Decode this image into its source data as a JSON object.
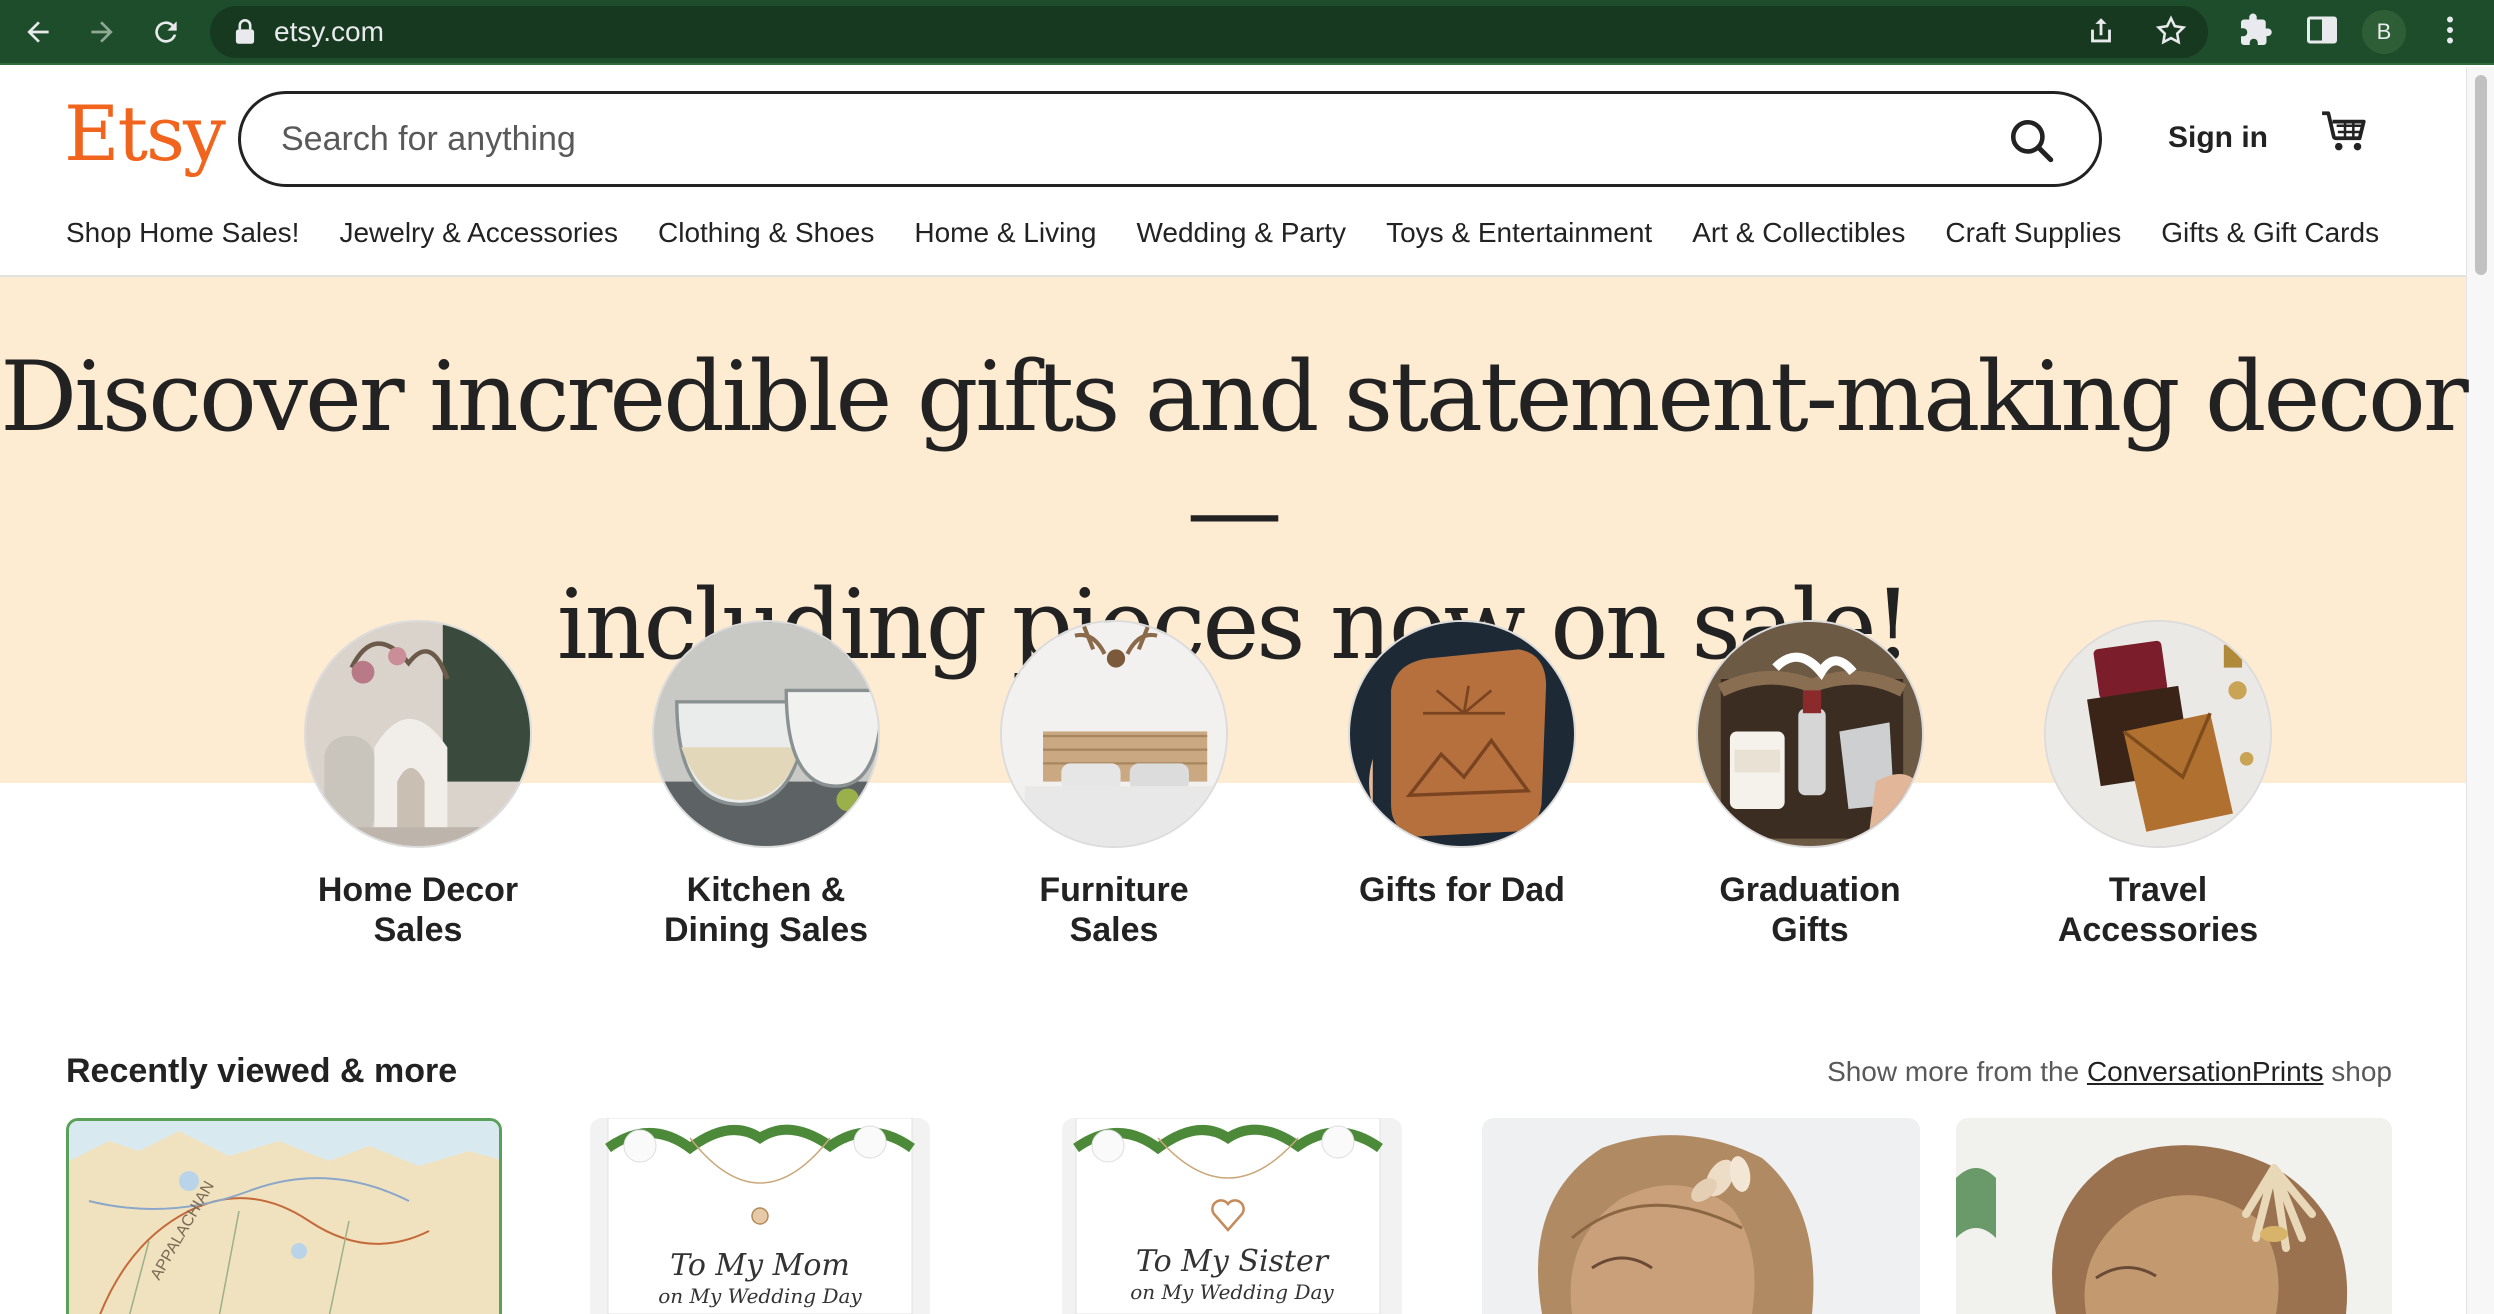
{
  "browser": {
    "url": "etsy.com",
    "profile_initial": "B"
  },
  "header": {
    "logo": "Etsy",
    "search_placeholder": "Search for anything",
    "sign_in": "Sign in"
  },
  "categories": [
    "Shop Home Sales!",
    "Jewelry & Accessories",
    "Clothing & Shoes",
    "Home & Living",
    "Wedding & Party",
    "Toys & Entertainment",
    "Art & Collectibles",
    "Craft Supplies",
    "Gifts & Gift Cards"
  ],
  "hero": {
    "line1": "Discover incredible gifts and statement-making decor—",
    "line2": "including pieces now on sale!"
  },
  "tiles": [
    {
      "line1": "Home Decor",
      "line2": "Sales"
    },
    {
      "line1": "Kitchen &",
      "line2": "Dining Sales"
    },
    {
      "line1": "Furniture",
      "line2": "Sales"
    },
    {
      "line1": "Gifts for Dad",
      "line2": ""
    },
    {
      "line1": "Graduation",
      "line2": "Gifts"
    },
    {
      "line1": "Travel",
      "line2": "Accessories"
    }
  ],
  "recently_viewed": {
    "title": "Recently viewed & more",
    "more_prefix": "Show more from the ",
    "shop_name": "ConversationPrints",
    "more_suffix": " shop",
    "cards": [
      {
        "kind": "map",
        "text": ""
      },
      {
        "kind": "card",
        "line1": "To My Mom",
        "line2": "on My Wedding Day"
      },
      {
        "kind": "card",
        "line1": "To My Sister",
        "line2": "on My Wedding Day"
      },
      {
        "kind": "photo",
        "text": ""
      },
      {
        "kind": "photo",
        "text": ""
      }
    ]
  },
  "colors": {
    "brand_orange": "#f1641e",
    "hero_band": "#fdebd2",
    "chrome_green": "#1e4d2b"
  }
}
